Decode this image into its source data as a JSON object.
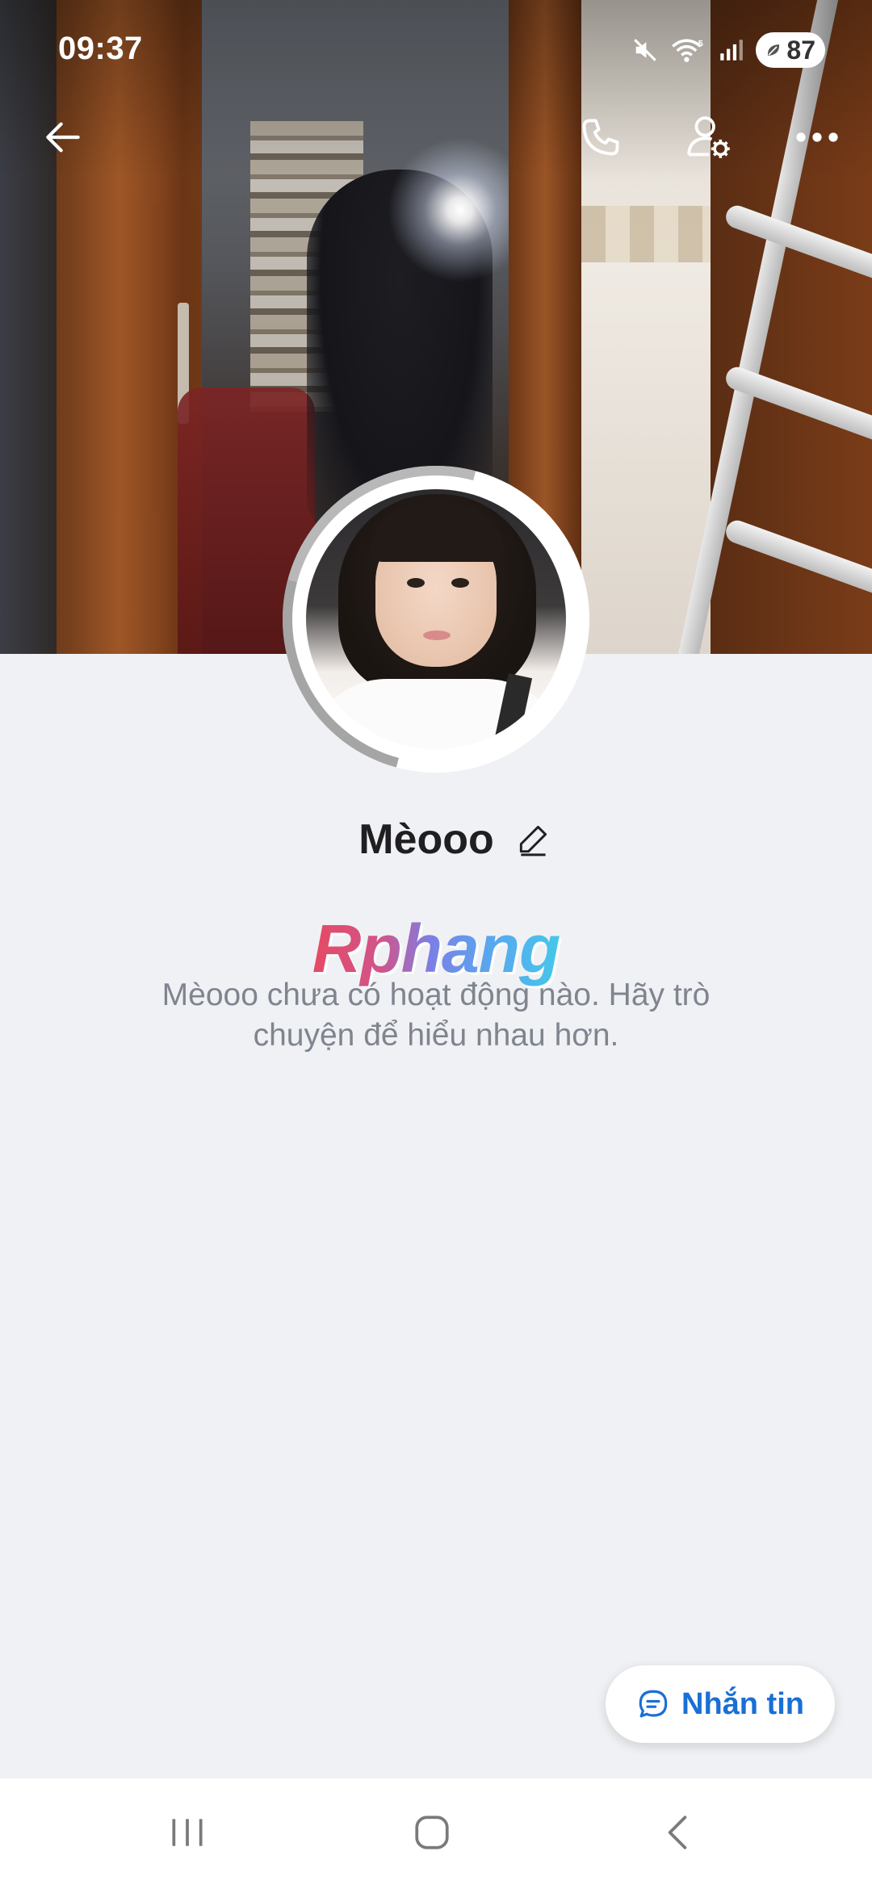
{
  "status_bar": {
    "time": "09:37",
    "battery_level": "87",
    "icons": [
      "mute-icon",
      "wifi-icon",
      "signal-icon",
      "battery-icon"
    ]
  },
  "top_actions": {
    "back_icon": "arrow-left-icon",
    "call_icon": "phone-icon",
    "profile_settings_icon": "user-settings-icon",
    "more_icon": "more-dots-icon"
  },
  "profile": {
    "name": "Mèooo",
    "edit_icon": "pencil-icon"
  },
  "watermark": {
    "text": "Rphang"
  },
  "empty_state": {
    "message": "Mèooo chưa có hoạt động nào. Hãy trò chuyện để hiểu nhau hơn."
  },
  "message_button": {
    "label": "Nhắn tin",
    "icon": "chat-bubble-icon"
  },
  "nav_bar": {
    "recent_icon": "recent-apps-icon",
    "home_icon": "home-icon",
    "back_icon": "back-icon"
  },
  "colors": {
    "background": "#f0f1f4",
    "accent": "#1a6fd6",
    "name_text": "#1f1f22",
    "secondary_text": "#7f858f"
  }
}
